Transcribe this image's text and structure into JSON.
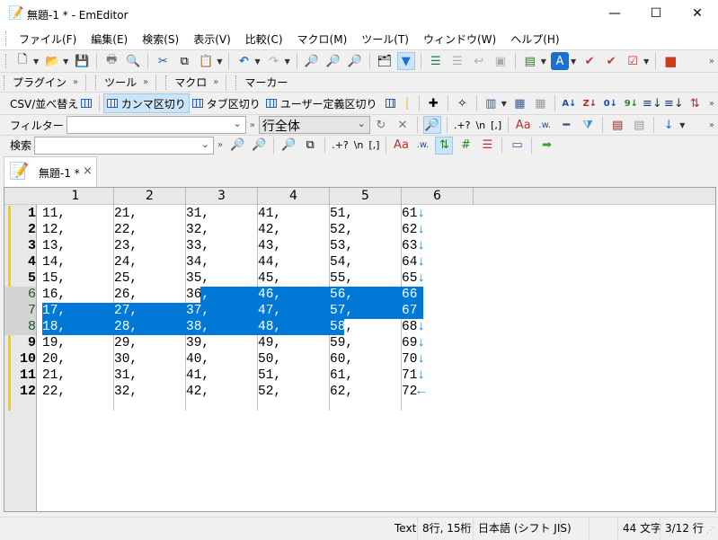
{
  "window": {
    "title": "無題-1 * - EmEditor",
    "minimize": "—",
    "maximize": "☐",
    "close": "✕"
  },
  "menu": [
    "ファイル(F)",
    "編集(E)",
    "検索(S)",
    "表示(V)",
    "比較(C)",
    "マクロ(M)",
    "ツール(T)",
    "ウィンドウ(W)",
    "ヘルプ(H)"
  ],
  "toolbars": {
    "plugin": "プラグイン",
    "tools": "ツール",
    "macro": "マクロ",
    "marker": "マーカー",
    "csv": {
      "label": "CSV/並べ替え",
      "comma": "カンマ区切り",
      "tab": "タブ区切り",
      "user": "ユーザー定義区切り",
      "active": "カンマ区切り"
    },
    "filter": {
      "label": "フィルター",
      "value": "",
      "scope": "行全体",
      "regex": ".+?",
      "newline": "\\n",
      "bracket": "[,]"
    },
    "search": {
      "label": "検索",
      "value": "",
      "regex": ".+?",
      "newline": "\\n",
      "bracket": "[,]"
    },
    "more": "»"
  },
  "document_tab": {
    "title": "無題-1 *",
    "close": "×"
  },
  "editor": {
    "columns": [
      "1",
      "2",
      "3",
      "4",
      "5",
      "6"
    ],
    "lines": [
      "1",
      "2",
      "3",
      "4",
      "5",
      "6",
      "7",
      "8",
      "9",
      "10",
      "11",
      "12"
    ],
    "rows": [
      [
        "11,",
        "21,",
        "31,",
        "41,",
        "51,",
        "61"
      ],
      [
        "12,",
        "22,",
        "32,",
        "42,",
        "52,",
        "62"
      ],
      [
        "13,",
        "23,",
        "33,",
        "43,",
        "53,",
        "63"
      ],
      [
        "14,",
        "24,",
        "34,",
        "44,",
        "54,",
        "64"
      ],
      [
        "15,",
        "25,",
        "35,",
        "45,",
        "55,",
        "65"
      ],
      [
        "16,",
        "26,",
        "36,",
        "46,",
        "56,",
        "66"
      ],
      [
        "17,",
        "27,",
        "37,",
        "47,",
        "57,",
        "67"
      ],
      [
        "18,",
        "28,",
        "38,",
        "48,",
        "58,",
        "68"
      ],
      [
        "19,",
        "29,",
        "39,",
        "49,",
        "59,",
        "69"
      ],
      [
        "20,",
        "30,",
        "40,",
        "50,",
        "60,",
        "70"
      ],
      [
        "21,",
        "31,",
        "41,",
        "51,",
        "61,",
        "71"
      ],
      [
        "22,",
        "32,",
        "42,",
        "52,",
        "62,",
        "72"
      ]
    ],
    "eol_marks": [
      "↓",
      "↓",
      "↓",
      "↓",
      "↓",
      "↓",
      "↓",
      "↓",
      "↓",
      "↓",
      "↓",
      "←"
    ],
    "selection": "6行3桁 〜 8行15桁",
    "selection_color": "#0078d7",
    "marker_color": "#f7d000"
  },
  "status": {
    "mode": "Text",
    "position": "8行, 15桁",
    "encoding": "日本語 (シフト JIS)",
    "chars": "44 文字",
    "lines": "3/12 行"
  }
}
